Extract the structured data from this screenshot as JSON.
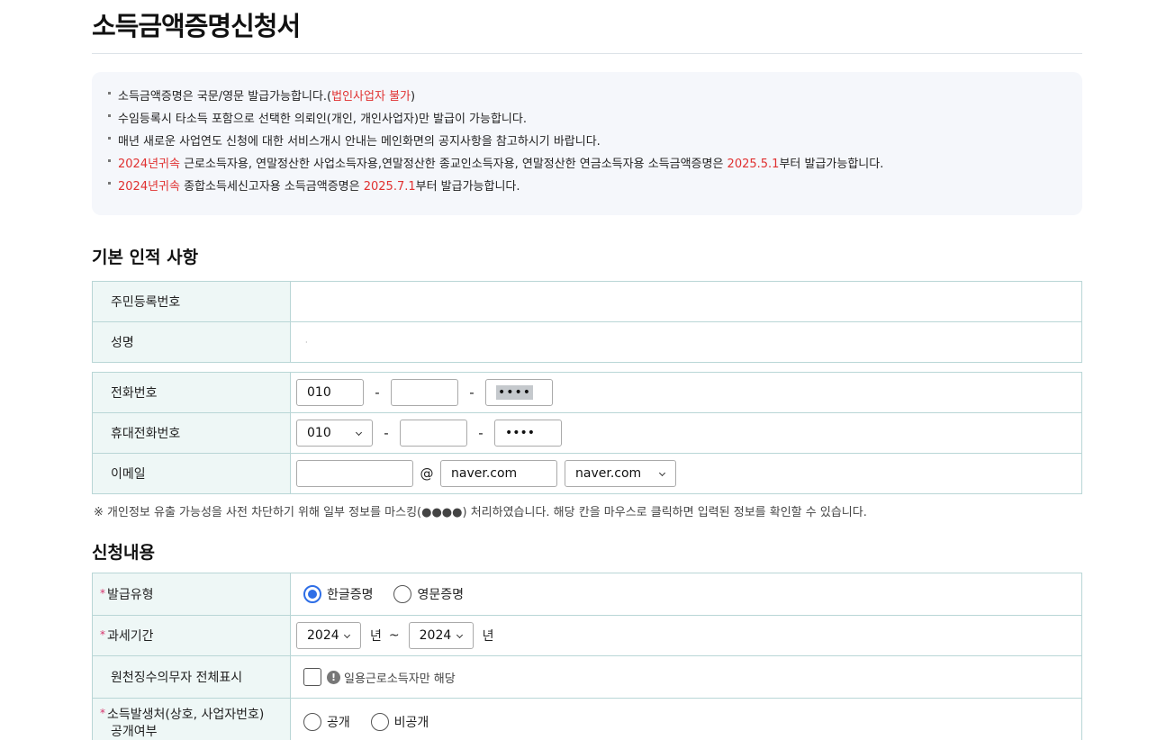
{
  "page": {
    "title": "소득금액증명신청서"
  },
  "notice": {
    "line1_text": "소득금액증명은 국문/영문 발급가능합니다.(",
    "line1_red": "법인사업자 불가",
    "line1_end": ")",
    "line2": "수임등록시 타소득 포함으로 선택한 의뢰인(개인, 개인사업자)만 발급이 가능합니다.",
    "line3": "매년 새로운 사업연도 신청에 대한 서비스개시 안내는 메인화면의 공지사항을 참고하시기 바랍니다.",
    "line4_red1": "2024년귀속",
    "line4_text": " 근로소득자용, 연말정산한 사업소득자용,연말정산한 종교인소득자용, 연말정산한 연금소득자용 소득금액증명은 ",
    "line4_red2": "2025.5.1",
    "line4_end": "부터 발급가능합니다.",
    "line5_red1": "2024년귀속",
    "line5_text": " 종합소득세신고자용 소득금액증명은 ",
    "line5_red2": "2025.7.1",
    "line5_end": "부터 발급가능합니다."
  },
  "basic": {
    "section_title": "기본 인적 사항",
    "resident_no_label": "주민등록번호",
    "resident_no_value": "",
    "name_label": "성명",
    "name_value": "·"
  },
  "contact": {
    "phone_label": "전화번호",
    "phone1": "010",
    "phone2": "",
    "phone3": "••••",
    "mobile_label": "휴대전화번호",
    "mobile1": "010",
    "mobile2": "",
    "mobile3": "••••",
    "dash": "-",
    "email_label": "이메일",
    "email_id": "",
    "at": "@",
    "email_domain": "naver.com",
    "email_domain_select": "naver.com"
  },
  "mask_note": "※ 개인정보 유출 가능성을 사전 차단하기 위해 일부 정보를 마스킹(●●●●) 처리하였습니다. 해당 칸을 마우스로 클릭하면 입력된 정보를 확인할 수 있습니다.",
  "apply": {
    "section_title": "신청내용",
    "required_mark": "*",
    "issue_type_label": "발급유형",
    "issue_korean": "한글증명",
    "issue_english": "영문증명",
    "tax_period_label": "과세기간",
    "year_from": "2024",
    "year_to": "2024",
    "year_unit": "년",
    "tilde": "~",
    "withholding_label": "원천징수의무자 전체표시",
    "withholding_hint": "일용근로소득자만 해당",
    "info_glyph": "!",
    "source_label_line1": "소득발생처(상호, 사업자번호)",
    "source_label_line2": "공개여부",
    "source_public": "공개",
    "source_private": "비공개"
  }
}
